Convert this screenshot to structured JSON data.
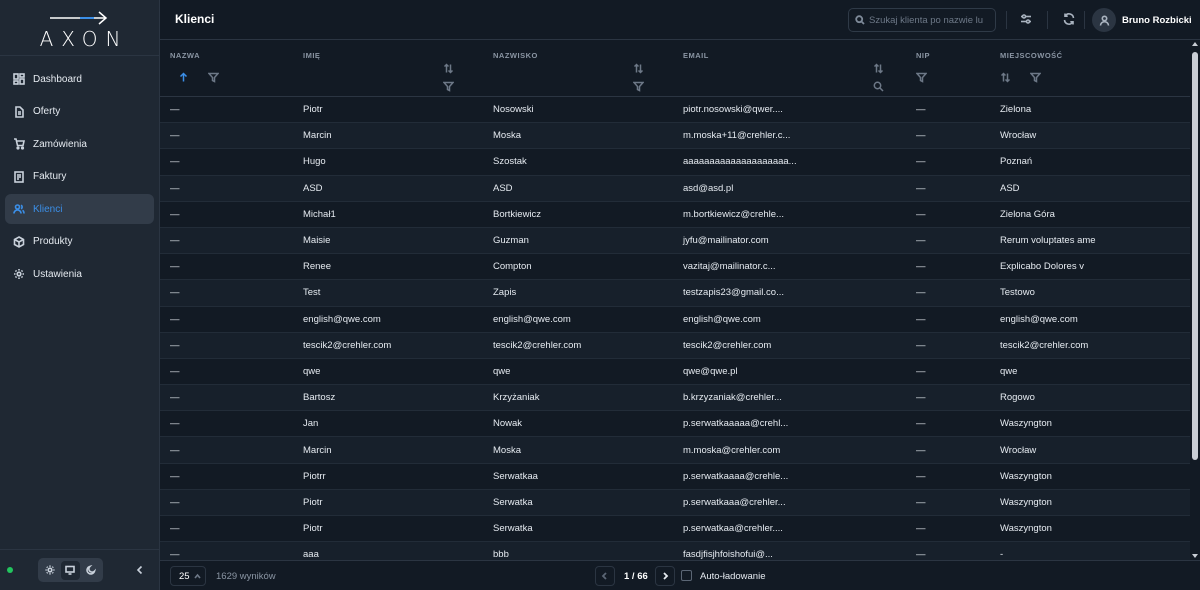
{
  "brand": {
    "name": "AXON"
  },
  "sidebar": {
    "items": [
      {
        "label": "Dashboard",
        "icon": "dashboard-icon"
      },
      {
        "label": "Oferty",
        "icon": "document-icon"
      },
      {
        "label": "Zamówienia",
        "icon": "cart-icon"
      },
      {
        "label": "Faktury",
        "icon": "invoice-icon"
      },
      {
        "label": "Klienci",
        "icon": "users-icon",
        "active": true
      },
      {
        "label": "Produkty",
        "icon": "box-icon"
      },
      {
        "label": "Ustawienia",
        "icon": "gear-icon"
      }
    ],
    "status_color": "#22c55e",
    "accent_color": "#3b8fe8"
  },
  "header": {
    "title": "Klienci",
    "search_placeholder": "Szukaj klienta po nazwie lu",
    "user_name": "Bruno Rozbicki"
  },
  "table": {
    "columns": [
      "NAZWA",
      "IMIĘ",
      "NAZWISKO",
      "EMAIL",
      "NIP",
      "MIEJSCOWOŚĆ"
    ],
    "rows": [
      [
        "—",
        "Piotr",
        "Nosowski",
        "piotr.nosowski@qwer....",
        "—",
        "Zielona"
      ],
      [
        "—",
        "Marcin",
        "Moska",
        "m.moska+11@crehler.c...",
        "—",
        "Wrocław"
      ],
      [
        "—",
        "Hugo",
        "Szostak",
        "aaaaaaaaaaaaaaaaaaaa...",
        "—",
        "Poznań"
      ],
      [
        "—",
        "ASD",
        "ASD",
        "asd@asd.pl",
        "—",
        "ASD"
      ],
      [
        "—",
        "Michał1",
        "Bortkiewicz",
        "m.bortkiewicz@crehle...",
        "—",
        "Zielona Góra"
      ],
      [
        "—",
        "Maisie",
        "Guzman",
        "jyfu@mailinator.com",
        "—",
        "Rerum voluptates ame"
      ],
      [
        "—",
        "Renee",
        "Compton",
        "vazitaj@mailinator.c...",
        "—",
        "Explicabo Dolores v"
      ],
      [
        "—",
        "Test",
        "Zapis",
        "testzapis23@gmail.co...",
        "—",
        "Testowo"
      ],
      [
        "—",
        "english@qwe.com",
        "english@qwe.com",
        "english@qwe.com",
        "—",
        "english@qwe.com"
      ],
      [
        "—",
        "tescik2@crehler.com",
        "tescik2@crehler.com",
        "tescik2@crehler.com",
        "—",
        "tescik2@crehler.com"
      ],
      [
        "—",
        "qwe",
        "qwe",
        "qwe@qwe.pl",
        "—",
        "qwe"
      ],
      [
        "—",
        "Bartosz",
        "Krzyżaniak",
        "b.krzyzaniak@crehler...",
        "—",
        "Rogowo"
      ],
      [
        "—",
        "Jan",
        "Nowak",
        "p.serwatkaaaaa@crehl...",
        "—",
        "Waszyngton"
      ],
      [
        "—",
        "Marcin",
        "Moska",
        "m.moska@crehler.com",
        "—",
        "Wrocław"
      ],
      [
        "—",
        "Piotrr",
        "Serwatkaa",
        "p.serwatkaaaa@crehle...",
        "—",
        "Waszyngton"
      ],
      [
        "—",
        "Piotr",
        "Serwatka",
        "p.serwatkaaa@crehler...",
        "—",
        "Waszyngton"
      ],
      [
        "—",
        "Piotr",
        "Serwatka",
        "p.serwatkaa@crehler....",
        "—",
        "Waszyngton"
      ],
      [
        "—",
        "aaa",
        "bbb",
        "fasdjfisjhfoishofui@...",
        "—",
        "-"
      ]
    ]
  },
  "footer": {
    "page_size": "25",
    "results": "1629 wyników",
    "pagination": "1 / 66",
    "autoload_label": "Auto-ładowanie"
  }
}
